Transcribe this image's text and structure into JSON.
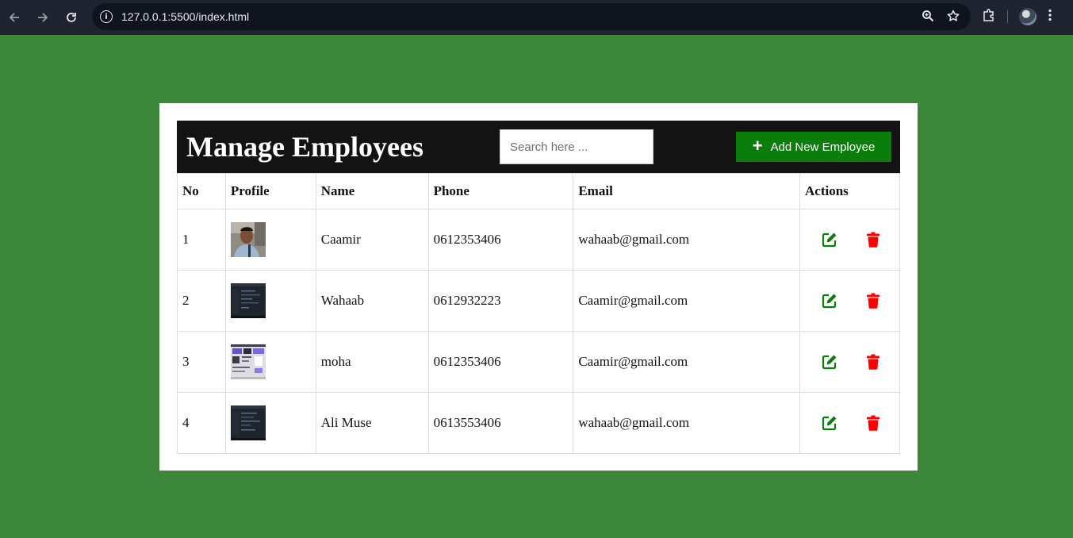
{
  "browser": {
    "url_host": "127.0.0.1",
    "url_path": ":5500/index.html",
    "back_icon": "arrow-left-icon",
    "forward_icon": "arrow-right-icon",
    "reload_icon": "reload-icon"
  },
  "header": {
    "title": "Manage Employees",
    "search_placeholder": "Search here ...",
    "add_button_label": "Add New Employee"
  },
  "table": {
    "columns": [
      "No",
      "Profile",
      "Name",
      "Phone",
      "Email",
      "Actions"
    ],
    "rows": [
      {
        "no": "1",
        "profile": "photo-portrait",
        "name": "Caamir",
        "phone": "0612353406",
        "email": "wahaab@gmail.com"
      },
      {
        "no": "2",
        "profile": "dark-screenshot",
        "name": "Wahaab",
        "phone": "0612932223",
        "email": "Caamir@gmail.com"
      },
      {
        "no": "3",
        "profile": "light-screenshot",
        "name": "moha",
        "phone": "0612353406",
        "email": "Caamir@gmail.com"
      },
      {
        "no": "4",
        "profile": "dark-screenshot",
        "name": "Ali Muse",
        "phone": "0613553406",
        "email": "wahaab@gmail.com"
      }
    ]
  },
  "colors": {
    "page_bg": "#3c873a",
    "header_bg": "#131313",
    "add_button": "#0a7d0a",
    "edit_icon": "#0a7d0a",
    "delete_icon": "#ff0000"
  }
}
